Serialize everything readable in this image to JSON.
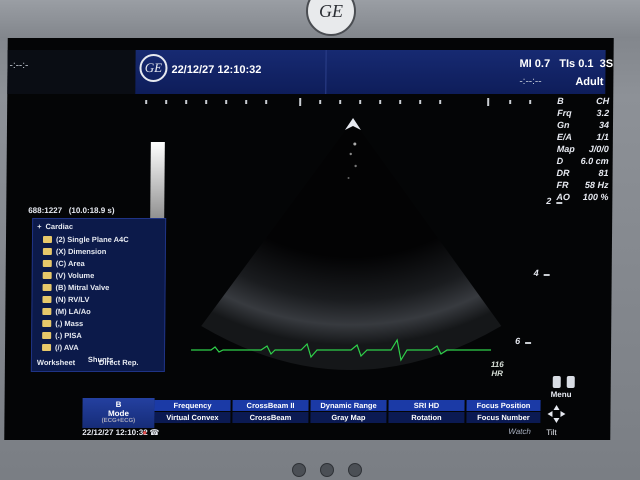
{
  "brand": {
    "logo_text": "GE"
  },
  "header": {
    "left_text": "-:--:-",
    "datetime": "22/12/27 12:10:32",
    "mi": "MI 0.7",
    "tis": "TIs 0.1",
    "probe": "3S",
    "mi2": "-:--:--",
    "preset": "Adult"
  },
  "left_panel": {
    "frame_info": "688:1227",
    "time_info": "(10.0:18.9 s)",
    "root_folder": "Cardiac",
    "folders": [
      "(2) Single Plane A4C",
      "(X) Dimension",
      "(C) Area",
      "(V) Volume",
      "(B) Mitral Valve",
      "(N) RV/LV",
      "(M) LA/Ao",
      "(,) Mass",
      "(.) PISA",
      "(/) AVA",
      "Shunts"
    ],
    "worksheet": "Worksheet",
    "direct_rep": "Direct Rep."
  },
  "params": [
    {
      "k": "B",
      "v": "CH"
    },
    {
      "k": "Frq",
      "v": "3.2"
    },
    {
      "k": "Gn",
      "v": "34"
    },
    {
      "k": "E/A",
      "v": "1/1"
    },
    {
      "k": "Map",
      "v": "J/0/0"
    },
    {
      "k": "D",
      "v": "6.0 cm"
    },
    {
      "k": "DR",
      "v": "81"
    },
    {
      "k": "FR",
      "v": "58 Hz"
    },
    {
      "k": "AO",
      "v": "100 %"
    }
  ],
  "depth_scale": [
    "2",
    "4",
    "6"
  ],
  "heart_rate": {
    "value": "116",
    "unit": "HR"
  },
  "mode": {
    "name": "B",
    "sub": "Mode",
    "small": "(ECG+ECG)"
  },
  "softkeys_top": [
    "Frequency",
    "CrossBeam II",
    "Dynamic Range",
    "SRI HD",
    "Focus Position"
  ],
  "softkeys_bottom": [
    "Virtual Convex",
    "CrossBeam",
    "Gray Map",
    "Rotation",
    "Focus Number"
  ],
  "footer": {
    "datetime": "22/12/27 12:10:32",
    "menu": "Menu",
    "watch": "Watch",
    "tilt": "Tilt"
  },
  "colors": {
    "header": "#172a72",
    "softkey": "#1b3aa6",
    "ecg": "#2fd04a",
    "folder": "#e7c86a"
  }
}
